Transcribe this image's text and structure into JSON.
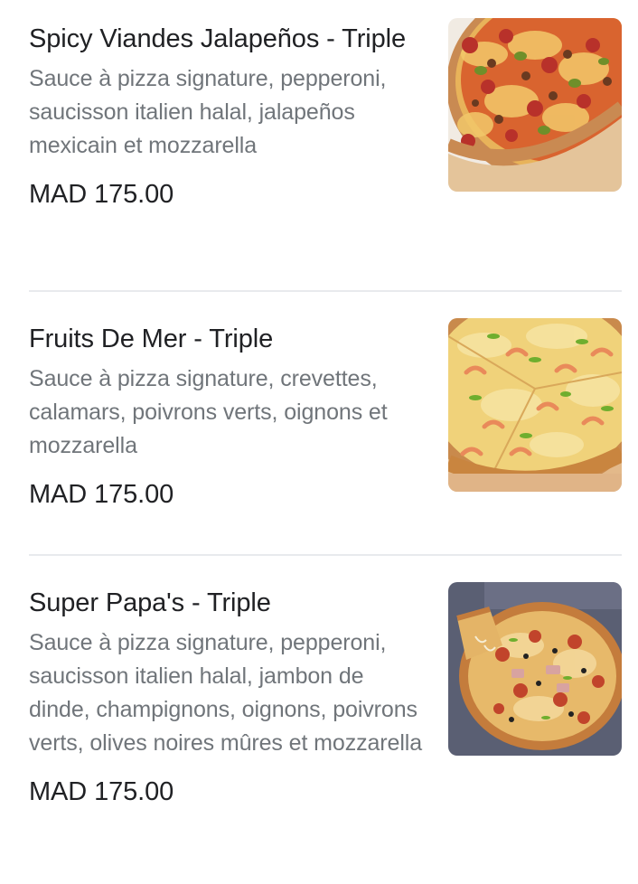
{
  "menu": {
    "items": [
      {
        "name": "Spicy Viandes Jalapeños - Triple",
        "description": "Sauce à pizza signature, pepperoni, saucisson italien halal, jalapeños mexicain et mozzarella",
        "price": "MAD 175.00",
        "image_icon": "pizza-photo"
      },
      {
        "name": "Fruits De Mer - Triple",
        "description": "Sauce à pizza signature, crevettes, calamars, poivrons verts, oignons et mozzarella",
        "price": "MAD 175.00",
        "image_icon": "pizza-photo"
      },
      {
        "name": "Super Papa's - Triple",
        "description": "Sauce à pizza signature, pepperoni, saucisson italien halal, jambon de dinde, champignons, oignons, poivrons verts, olives noires mûres et mozzarella",
        "price": "MAD 175.00",
        "image_icon": "pizza-photo"
      }
    ]
  }
}
